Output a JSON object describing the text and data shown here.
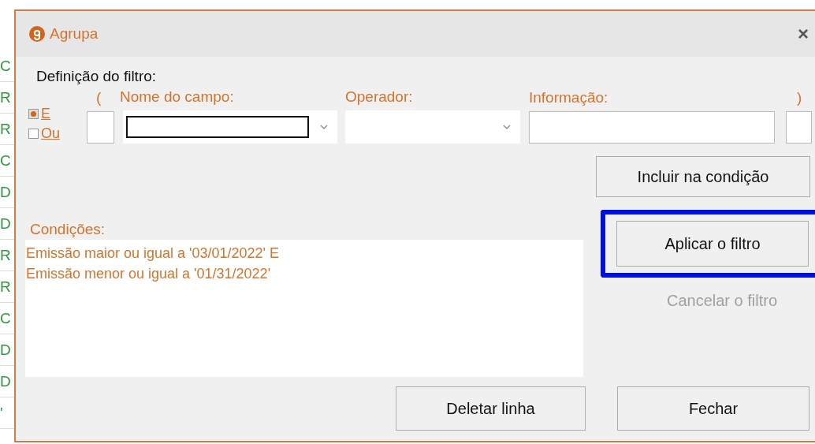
{
  "background_column": [
    "C",
    "R",
    "R",
    "C",
    "D",
    "D",
    "R",
    "R",
    "C",
    "D",
    "D",
    "'"
  ],
  "window": {
    "title": "Agrupa",
    "close": "×"
  },
  "filter": {
    "title": "Definição do filtro:",
    "logic": [
      {
        "label": "E",
        "selected": true
      },
      {
        "label": "Ou",
        "selected": false
      }
    ],
    "open_paren": "(",
    "field_label": "Nome do campo:",
    "field_focused": true,
    "operator_label": "Operador:",
    "info_label": "Informação:",
    "close_paren": ")"
  },
  "include_button": "Incluir na condição",
  "conditions": {
    "label": "Condições:",
    "lines": [
      "Emissão maior ou igual a '03/01/2022' E",
      "Emissão menor ou igual a '01/31/2022'"
    ]
  },
  "apply_button": {
    "label": "Aplicar o filtro",
    "highlighted": true
  },
  "cancel_button": {
    "label": "Cancelar o filtro",
    "disabled": true
  },
  "delete_button": "Deletar linha",
  "close_button": "Fechar"
}
